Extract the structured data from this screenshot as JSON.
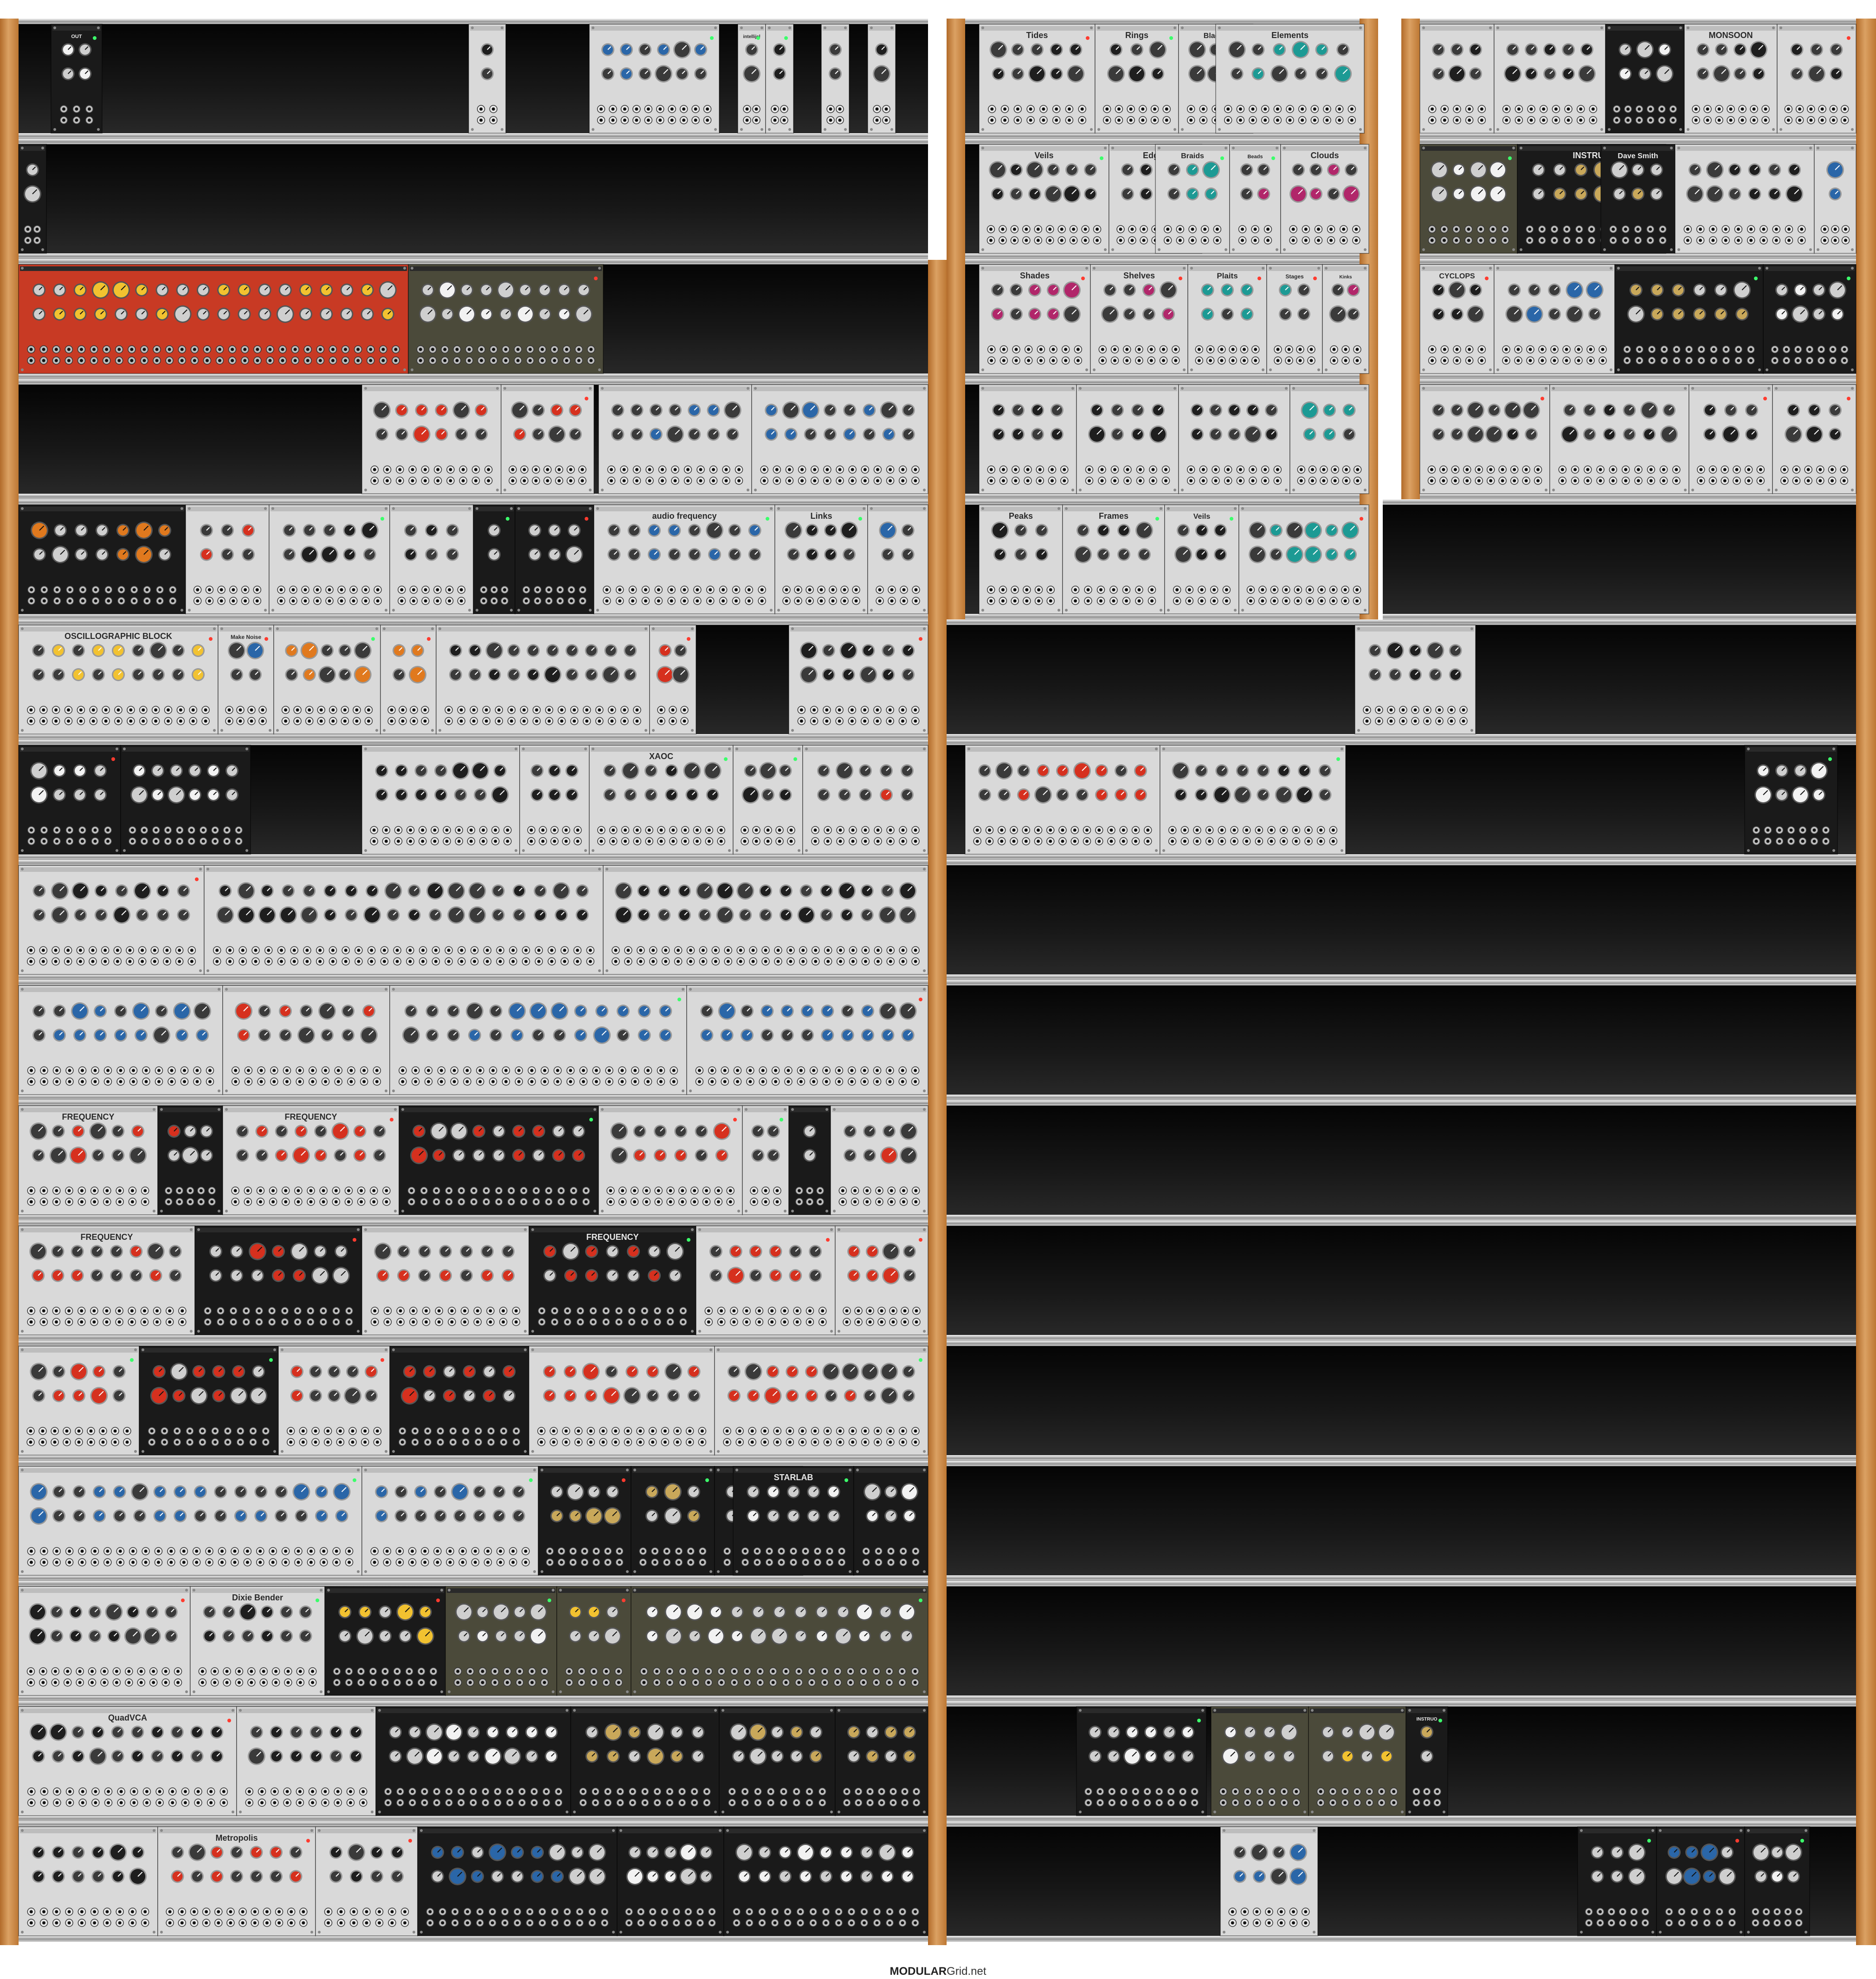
{
  "footer": {
    "brand_bold": "MODULAR",
    "brand_rest": "Grid.net"
  },
  "colors": {
    "wood": "#c8853f",
    "rail": "#b0b0b0",
    "bg_dark": "#0b0b0b",
    "panel_silver": "#d9d9d9",
    "panel_black": "#1a1a1a",
    "panel_red": "#c83a24",
    "panel_olive": "#4b4a3a",
    "accent_red": "#d6301e",
    "accent_blue": "#2a66a8",
    "accent_teal": "#1c9a94",
    "accent_magenta": "#b1266a",
    "accent_orange": "#e0791e",
    "accent_yellow": "#f2c230",
    "accent_gold": "#c9a85a"
  },
  "cases": [
    {
      "name": "case-left",
      "rows": 15
    },
    {
      "name": "case-middle",
      "rows": 7
    },
    {
      "name": "case-right",
      "rows": 4
    }
  ],
  "rows": [
    {
      "name": "left-row-1",
      "case": "left",
      "modules": [
        {
          "theme": "black",
          "accent": "white",
          "label": "OUT"
        },
        {
          "theme": "silver",
          "accent": "black",
          "label": ""
        },
        {
          "theme": "silver",
          "accent": "blue",
          "label": ""
        },
        {
          "theme": "silver",
          "accent": "black",
          "label": "intellijel"
        },
        {
          "theme": "silver",
          "accent": "black",
          "label": ""
        },
        {
          "theme": "silver",
          "accent": "black",
          "label": ""
        },
        {
          "theme": "silver",
          "accent": "black",
          "label": ""
        }
      ]
    },
    {
      "name": "left-row-2",
      "case": "left",
      "modules": [
        {
          "theme": "black",
          "accent": "white",
          "label": ""
        }
      ]
    },
    {
      "name": "left-row-3",
      "case": "left",
      "modules": [
        {
          "theme": "red",
          "accent": "yellow",
          "label": ""
        },
        {
          "theme": "olive",
          "accent": "white",
          "label": ""
        }
      ]
    },
    {
      "name": "left-row-4",
      "case": "left",
      "modules": [
        {
          "theme": "silver",
          "accent": "red",
          "label": ""
        },
        {
          "theme": "silver",
          "accent": "red",
          "label": ""
        },
        {
          "theme": "silver",
          "accent": "blue",
          "label": ""
        },
        {
          "theme": "silver",
          "accent": "blue",
          "label": ""
        }
      ]
    },
    {
      "name": "left-row-5",
      "case": "left",
      "modules": [
        {
          "theme": "black",
          "accent": "orange",
          "label": ""
        },
        {
          "theme": "silver",
          "accent": "red",
          "label": ""
        },
        {
          "theme": "silver",
          "accent": "black",
          "label": ""
        },
        {
          "theme": "silver",
          "accent": "black",
          "label": ""
        },
        {
          "theme": "black",
          "accent": "white",
          "label": ""
        },
        {
          "theme": "black",
          "accent": "red",
          "label": ""
        },
        {
          "theme": "silver",
          "accent": "blue",
          "label": "audio frequency"
        },
        {
          "theme": "silver",
          "accent": "black",
          "label": "Links"
        },
        {
          "theme": "silver",
          "accent": "blue",
          "label": ""
        }
      ]
    },
    {
      "name": "left-row-6",
      "case": "left",
      "modules": [
        {
          "theme": "silver",
          "accent": "yellow",
          "label": "OSCILLOGRAPHIC BLOCK"
        },
        {
          "theme": "silver",
          "accent": "blue",
          "label": "Make Noise"
        },
        {
          "theme": "silver",
          "accent": "orange",
          "label": ""
        },
        {
          "theme": "silver",
          "accent": "orange",
          "label": ""
        },
        {
          "theme": "silver",
          "accent": "black",
          "label": ""
        },
        {
          "theme": "silver",
          "accent": "red",
          "label": ""
        },
        {
          "theme": "silver",
          "accent": "black",
          "label": ""
        }
      ]
    },
    {
      "name": "left-row-7",
      "case": "left",
      "modules": [
        {
          "theme": "black",
          "accent": "white",
          "label": ""
        },
        {
          "theme": "black",
          "accent": "white",
          "label": ""
        },
        {
          "theme": "silver",
          "accent": "black",
          "label": ""
        },
        {
          "theme": "silver",
          "accent": "black",
          "label": ""
        },
        {
          "theme": "silver",
          "accent": "black",
          "label": "XAOC"
        },
        {
          "theme": "silver",
          "accent": "black",
          "label": ""
        },
        {
          "theme": "silver",
          "accent": "red",
          "label": ""
        }
      ]
    },
    {
      "name": "left-row-8",
      "case": "left",
      "modules": [
        {
          "theme": "silver",
          "accent": "black",
          "label": ""
        },
        {
          "theme": "silver",
          "accent": "black",
          "label": ""
        },
        {
          "theme": "silver",
          "accent": "black",
          "label": ""
        }
      ]
    },
    {
      "name": "left-row-9",
      "case": "left",
      "modules": [
        {
          "theme": "silver",
          "accent": "blue",
          "label": ""
        },
        {
          "theme": "silver",
          "accent": "red",
          "label": ""
        },
        {
          "theme": "silver",
          "accent": "blue",
          "label": ""
        },
        {
          "theme": "silver",
          "accent": "blue",
          "label": ""
        }
      ]
    },
    {
      "name": "left-row-10",
      "case": "left",
      "modules": [
        {
          "theme": "silver",
          "accent": "red",
          "label": "FREQUENCY"
        },
        {
          "theme": "black",
          "accent": "red",
          "label": ""
        },
        {
          "theme": "silver",
          "accent": "red",
          "label": "FREQUENCY"
        },
        {
          "theme": "black",
          "accent": "red",
          "label": ""
        },
        {
          "theme": "silver",
          "accent": "red",
          "label": ""
        },
        {
          "theme": "silver",
          "accent": "red",
          "label": ""
        },
        {
          "theme": "black",
          "accent": "red",
          "label": ""
        },
        {
          "theme": "silver",
          "accent": "red",
          "label": ""
        }
      ]
    },
    {
      "name": "left-row-11",
      "case": "left",
      "modules": [
        {
          "theme": "silver",
          "accent": "red",
          "label": "FREQUENCY"
        },
        {
          "theme": "black",
          "accent": "red",
          "label": ""
        },
        {
          "theme": "silver",
          "accent": "red",
          "label": ""
        },
        {
          "theme": "black",
          "accent": "red",
          "label": "FREQUENCY"
        },
        {
          "theme": "silver",
          "accent": "red",
          "label": ""
        },
        {
          "theme": "silver",
          "accent": "red",
          "label": ""
        }
      ]
    },
    {
      "name": "left-row-12",
      "case": "left",
      "modules": [
        {
          "theme": "silver",
          "accent": "red",
          "label": ""
        },
        {
          "theme": "black",
          "accent": "red",
          "label": ""
        },
        {
          "theme": "silver",
          "accent": "red",
          "label": ""
        },
        {
          "theme": "black",
          "accent": "red",
          "label": ""
        },
        {
          "theme": "silver",
          "accent": "red",
          "label": ""
        },
        {
          "theme": "silver",
          "accent": "red",
          "label": ""
        }
      ]
    },
    {
      "name": "left-row-13",
      "case": "left",
      "modules": [
        {
          "theme": "silver",
          "accent": "blue",
          "label": ""
        },
        {
          "theme": "silver",
          "accent": "blue",
          "label": ""
        },
        {
          "theme": "black",
          "accent": "gold",
          "label": ""
        },
        {
          "theme": "black",
          "accent": "gold",
          "label": ""
        },
        {
          "theme": "black",
          "accent": "white",
          "label": ""
        },
        {
          "theme": "black",
          "accent": "white",
          "label": "STARLAB"
        },
        {
          "theme": "black",
          "accent": "white",
          "label": ""
        }
      ]
    },
    {
      "name": "left-row-14",
      "case": "left",
      "modules": [
        {
          "theme": "silver",
          "accent": "black",
          "label": ""
        },
        {
          "theme": "silver",
          "accent": "black",
          "label": "Dixie Bender"
        },
        {
          "theme": "black",
          "accent": "yellow",
          "label": ""
        },
        {
          "theme": "olive",
          "accent": "white",
          "label": ""
        },
        {
          "theme": "olive",
          "accent": "yellow",
          "label": ""
        },
        {
          "theme": "olive",
          "accent": "white",
          "label": ""
        }
      ]
    },
    {
      "name": "left-row-15",
      "case": "left",
      "modules": [
        {
          "theme": "silver",
          "accent": "black",
          "label": "QuadVCA"
        },
        {
          "theme": "silver",
          "accent": "black",
          "label": ""
        },
        {
          "theme": "black",
          "accent": "white",
          "label": ""
        },
        {
          "theme": "black",
          "accent": "gold",
          "label": ""
        },
        {
          "theme": "black",
          "accent": "gold",
          "label": ""
        },
        {
          "theme": "black",
          "accent": "gold",
          "label": ""
        }
      ]
    },
    {
      "name": "left-row-16",
      "case": "left",
      "modules": [
        {
          "theme": "silver",
          "accent": "black",
          "label": ""
        },
        {
          "theme": "silver",
          "accent": "red",
          "label": "Metropolis"
        },
        {
          "theme": "silver",
          "accent": "black",
          "label": ""
        },
        {
          "theme": "black",
          "accent": "blue",
          "label": ""
        },
        {
          "theme": "black",
          "accent": "white",
          "label": ""
        },
        {
          "theme": "black",
          "accent": "white",
          "label": ""
        }
      ]
    },
    {
      "name": "middle-row-1",
      "case": "middle",
      "modules": [
        {
          "theme": "silver",
          "accent": "black",
          "label": "Tides"
        },
        {
          "theme": "silver",
          "accent": "black",
          "label": "Rings"
        },
        {
          "theme": "silver",
          "accent": "black",
          "label": "Blades"
        },
        {
          "theme": "silver",
          "accent": "teal",
          "label": "Elements"
        }
      ]
    },
    {
      "name": "middle-row-2",
      "case": "middle",
      "modules": [
        {
          "theme": "silver",
          "accent": "black",
          "label": "Veils"
        },
        {
          "theme": "silver",
          "accent": "black",
          "label": "Edges"
        },
        {
          "theme": "silver",
          "accent": "teal",
          "label": "Braids"
        },
        {
          "theme": "silver",
          "accent": "magenta",
          "label": "Beads"
        },
        {
          "theme": "silver",
          "accent": "magenta",
          "label": "Clouds"
        }
      ]
    },
    {
      "name": "middle-row-3",
      "case": "middle",
      "modules": [
        {
          "theme": "silver",
          "accent": "magenta",
          "label": "Shades"
        },
        {
          "theme": "silver",
          "accent": "magenta",
          "label": "Shelves"
        },
        {
          "theme": "silver",
          "accent": "teal",
          "label": "Plaits"
        },
        {
          "theme": "silver",
          "accent": "teal",
          "label": "Stages"
        },
        {
          "theme": "silver",
          "accent": "magenta",
          "label": "Kinks"
        }
      ]
    },
    {
      "name": "middle-row-4",
      "case": "middle",
      "modules": [
        {
          "theme": "silver",
          "accent": "black",
          "label": ""
        },
        {
          "theme": "silver",
          "accent": "black",
          "label": ""
        },
        {
          "theme": "silver",
          "accent": "black",
          "label": ""
        },
        {
          "theme": "silver",
          "accent": "teal",
          "label": ""
        }
      ]
    },
    {
      "name": "middle-row-5",
      "case": "middle",
      "modules": [
        {
          "theme": "silver",
          "accent": "black",
          "label": "Peaks"
        },
        {
          "theme": "silver",
          "accent": "black",
          "label": "Frames"
        },
        {
          "theme": "silver",
          "accent": "black",
          "label": "Veils"
        },
        {
          "theme": "silver",
          "accent": "teal",
          "label": ""
        }
      ]
    },
    {
      "name": "middle-row-6",
      "case": "middle",
      "modules": []
    },
    {
      "name": "middle-row-7",
      "case": "middle",
      "modules": [
        {
          "theme": "silver",
          "accent": "red",
          "label": ""
        },
        {
          "theme": "silver",
          "accent": "black",
          "label": ""
        }
      ]
    },
    {
      "name": "middle-row-15",
      "case": "middle",
      "modules": [
        {
          "theme": "black",
          "accent": "white",
          "label": ""
        },
        {
          "theme": "olive",
          "accent": "white",
          "label": ""
        },
        {
          "theme": "olive",
          "accent": "yellow",
          "label": ""
        },
        {
          "theme": "black",
          "accent": "gold",
          "label": "INSTRUO"
        }
      ]
    },
    {
      "name": "middle-row-16",
      "case": "middle",
      "modules": [
        {
          "theme": "silver",
          "accent": "blue",
          "label": ""
        }
      ]
    },
    {
      "name": "right-row-1",
      "case": "right",
      "modules": [
        {
          "theme": "silver",
          "accent": "black",
          "label": ""
        },
        {
          "theme": "silver",
          "accent": "black",
          "label": ""
        },
        {
          "theme": "black",
          "accent": "white",
          "label": ""
        },
        {
          "theme": "silver",
          "accent": "black",
          "label": "MONSOON"
        },
        {
          "theme": "silver",
          "accent": "black",
          "label": ""
        }
      ]
    },
    {
      "name": "right-row-2",
      "case": "right",
      "modules": [
        {
          "theme": "olive",
          "accent": "white",
          "label": ""
        },
        {
          "theme": "black",
          "accent": "gold",
          "label": "INSTRUO"
        },
        {
          "theme": "black",
          "accent": "gold",
          "label": "Dave Smith"
        },
        {
          "theme": "silver",
          "accent": "black",
          "label": ""
        },
        {
          "theme": "silver",
          "accent": "blue",
          "label": ""
        }
      ]
    },
    {
      "name": "right-row-3",
      "case": "right",
      "modules": [
        {
          "theme": "silver",
          "accent": "black",
          "label": "CYCLOPS"
        },
        {
          "theme": "silver",
          "accent": "blue",
          "label": ""
        },
        {
          "theme": "black",
          "accent": "gold",
          "label": ""
        },
        {
          "theme": "black",
          "accent": "white",
          "label": ""
        }
      ]
    },
    {
      "name": "right-row-4",
      "case": "right",
      "modules": [
        {
          "theme": "silver",
          "accent": "black",
          "label": ""
        },
        {
          "theme": "silver",
          "accent": "black",
          "label": ""
        },
        {
          "theme": "silver",
          "accent": "black",
          "label": ""
        },
        {
          "theme": "silver",
          "accent": "black",
          "label": ""
        }
      ]
    },
    {
      "name": "right-row-6",
      "case": "right",
      "modules": [
        {
          "theme": "silver",
          "accent": "black",
          "label": ""
        }
      ]
    },
    {
      "name": "right-row-7",
      "case": "right",
      "modules": [
        {
          "theme": "black",
          "accent": "white",
          "label": ""
        }
      ]
    },
    {
      "name": "right-row-16",
      "case": "right",
      "modules": [
        {
          "theme": "black",
          "accent": "yellow",
          "label": ""
        },
        {
          "theme": "black",
          "accent": "blue",
          "label": ""
        },
        {
          "theme": "black",
          "accent": "white",
          "label": ""
        }
      ]
    }
  ]
}
